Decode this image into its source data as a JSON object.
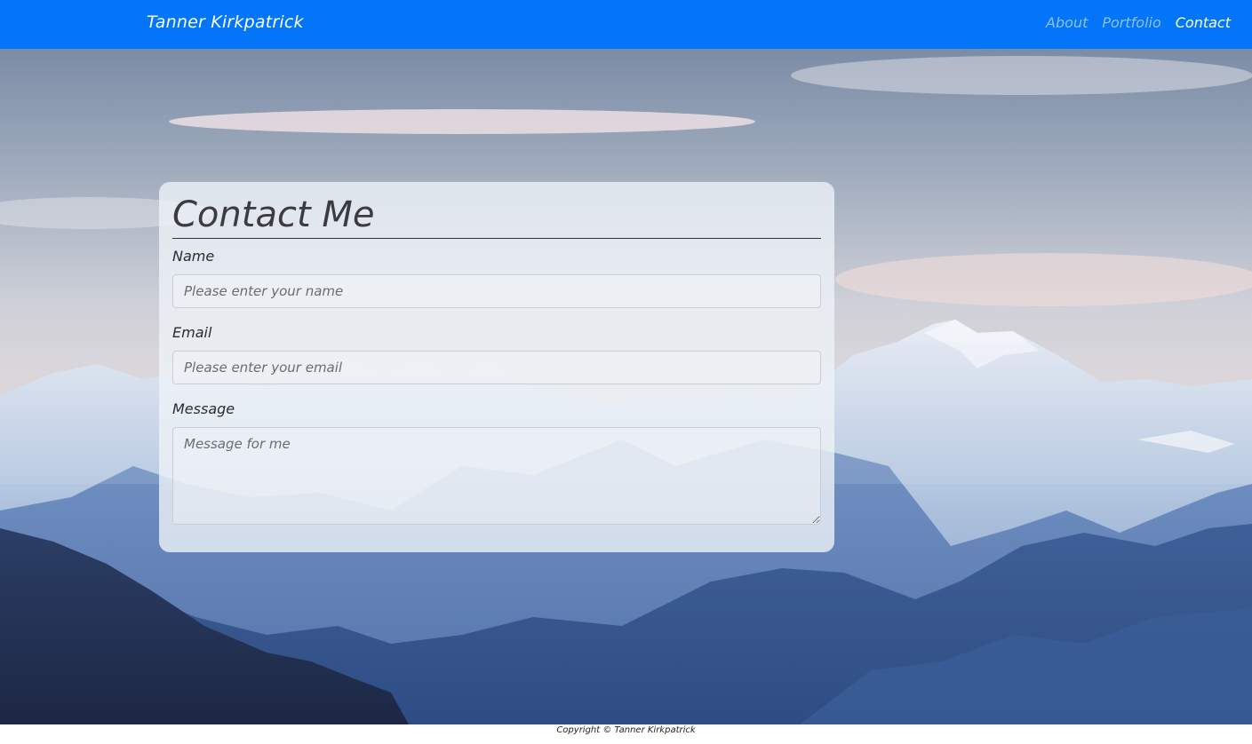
{
  "navbar": {
    "brand": "Tanner Kirkpatrick",
    "links": [
      {
        "label": "About",
        "active": false
      },
      {
        "label": "Portfolio",
        "active": false
      },
      {
        "label": "Contact",
        "active": true
      }
    ],
    "background_color": "#0275f8"
  },
  "contact_form": {
    "title": "Contact Me",
    "name_label": "Name",
    "name_placeholder": "Please enter your name",
    "email_label": "Email",
    "email_placeholder": "Please enter your email",
    "message_label": "Message",
    "message_placeholder": "Message for me"
  },
  "footer": {
    "copyright": "Copyright © Tanner Kirkpatrick"
  }
}
